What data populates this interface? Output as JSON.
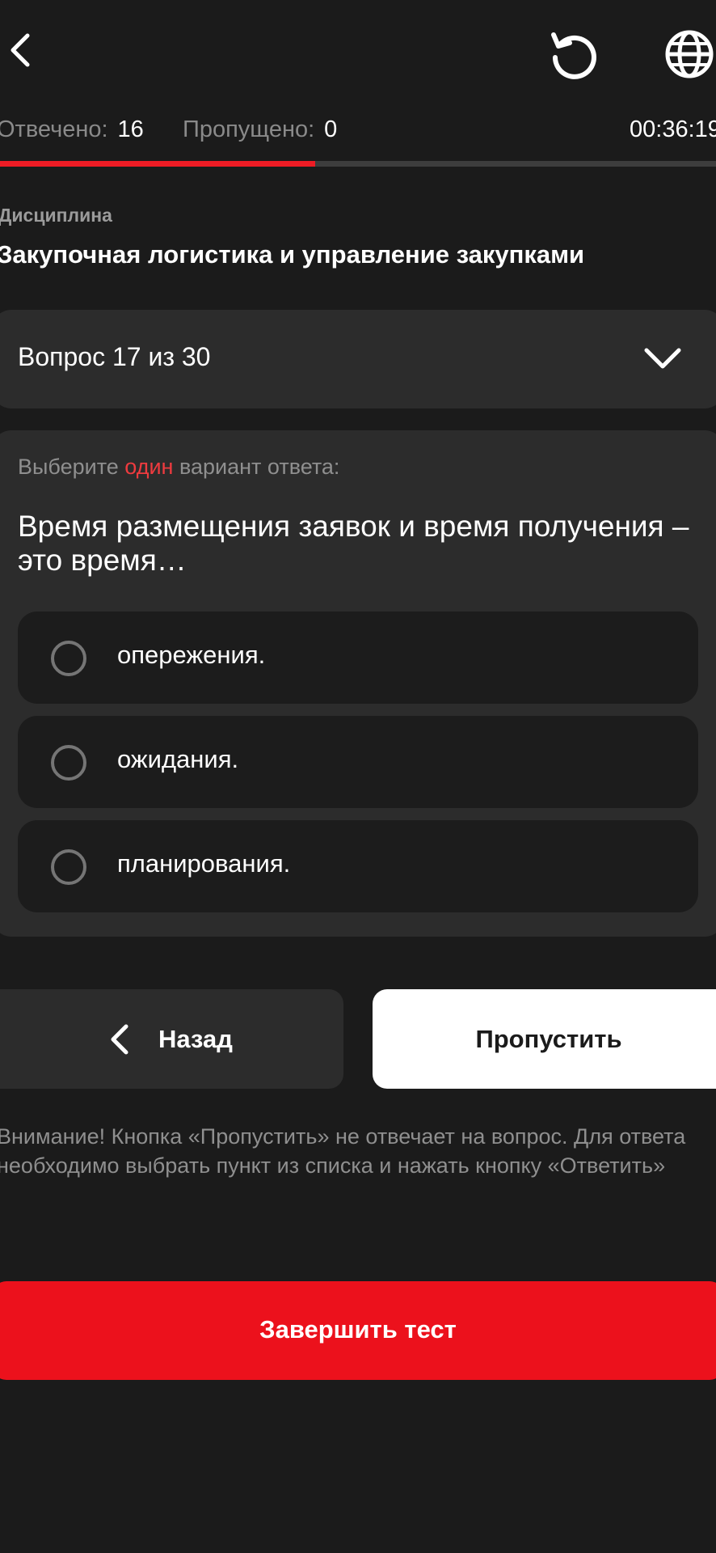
{
  "header": {
    "back_icon": "chevron-left-icon",
    "reload_icon": "reload-icon",
    "language_icon": "globe-icon"
  },
  "stats": {
    "answered_label": "Отвечено:",
    "answered_value": "16",
    "skipped_label": "Пропущено:",
    "skipped_value": "0",
    "timer": "00:36:19"
  },
  "progress": {
    "fraction": 0.44,
    "track_color": "#3d3d3d",
    "fill_color": "#ee1c25"
  },
  "discipline": {
    "label": "Дисциплина",
    "title": "Закупочная логистика и управление закупками"
  },
  "question_selector": {
    "label": "Вопрос 17 из 30",
    "icon": "chevron-down-icon"
  },
  "question": {
    "instruction_prefix": "Выберите ",
    "instruction_accent": "один",
    "instruction_suffix": " вариант ответа:",
    "text": "Время размещения заявок и время получения – это время…",
    "options": [
      {
        "label": "опережения."
      },
      {
        "label": "ожидания."
      },
      {
        "label": "планирования."
      }
    ]
  },
  "actions": {
    "back_label": "Назад",
    "skip_label": "Пропустить",
    "finish_label": "Завершить тест"
  },
  "notice": "Внимание! Кнопка «Пропустить» не отвечает на вопрос. Для ответа необходимо выбрать пункт из списка и нажать кнопку «Ответить»",
  "colors": {
    "background": "#1b1b1b",
    "card": "#2c2c2c",
    "option": "#1c1c1c",
    "accent": "#ec111c",
    "muted_text": "#8f8f8f"
  }
}
